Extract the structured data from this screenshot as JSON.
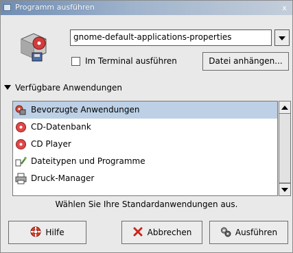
{
  "window": {
    "title": "Programm ausführen",
    "close_label": "x"
  },
  "command": {
    "value": "gnome-default-applications-properties"
  },
  "terminal_checkbox": {
    "label": "Im Terminal ausführen",
    "checked": false
  },
  "attach_file_button": {
    "label": "Datei anhängen..."
  },
  "expander": {
    "label": "Verfügbare Anwendungen",
    "expanded": true
  },
  "applications": [
    {
      "label": "Bevorzugte Anwendungen",
      "icon": "preferences-icon",
      "selected": true
    },
    {
      "label": "CD-Datenbank",
      "icon": "cd-icon",
      "selected": false
    },
    {
      "label": "CD Player",
      "icon": "cd-icon",
      "selected": false
    },
    {
      "label": "Dateitypen und Programme",
      "icon": "filetypes-icon",
      "selected": false
    },
    {
      "label": "Druck-Manager",
      "icon": "printer-icon",
      "selected": false
    }
  ],
  "status_text": "Wählen Sie Ihre Standardanwendungen aus.",
  "buttons": {
    "help": "Hilfe",
    "cancel": "Abbrechen",
    "run": "Ausführen"
  },
  "colors": {
    "selection": "#bdd0e6",
    "titlebar": "#6f8db3",
    "window_bg": "#e9e9e9"
  }
}
